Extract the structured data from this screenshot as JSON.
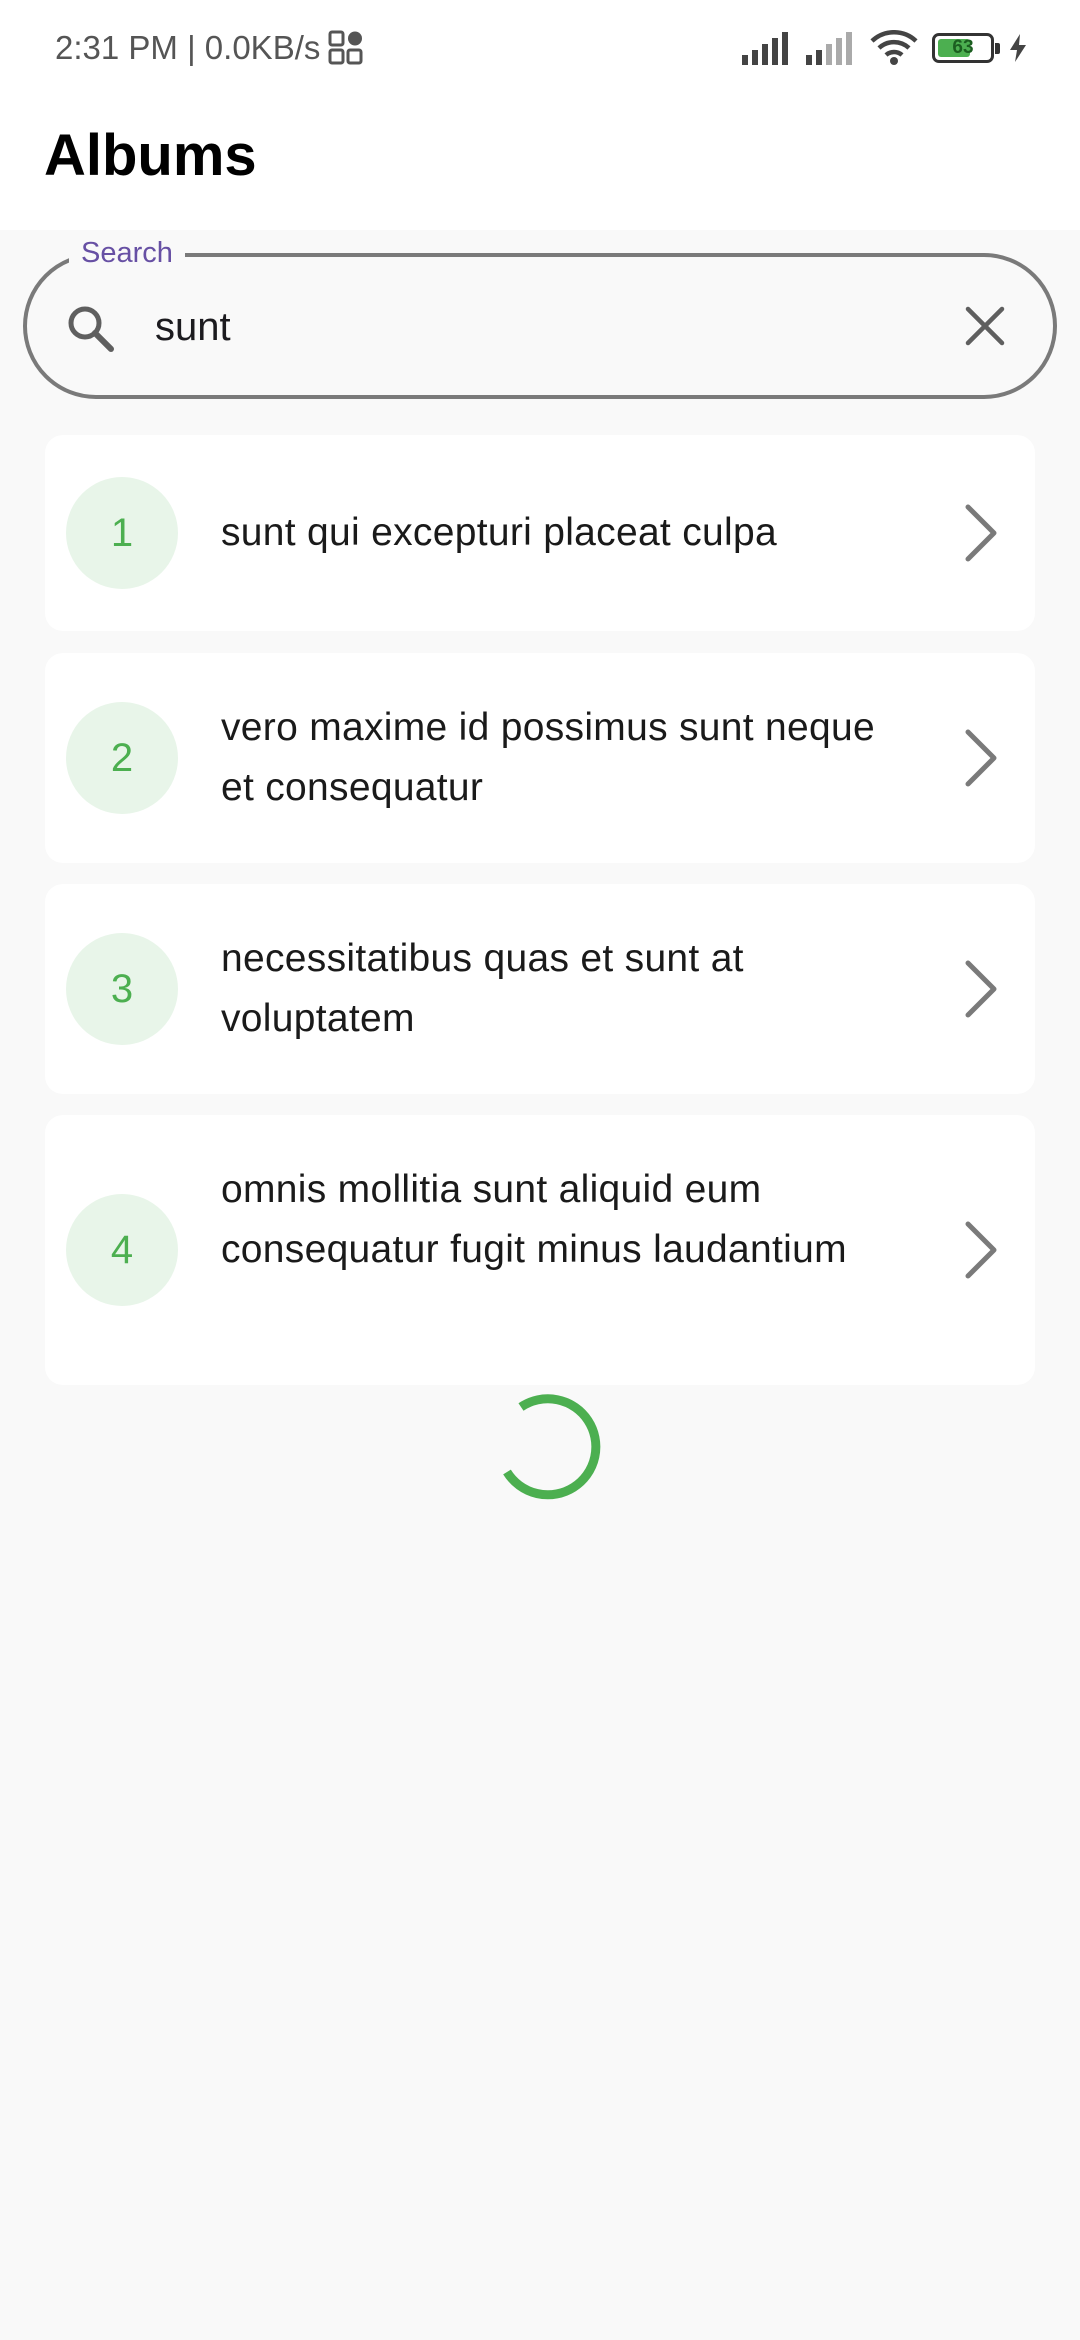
{
  "status_bar": {
    "time_speed": "2:31 PM | 0.0KB/s",
    "battery_level": "63",
    "icons": [
      "apps-icon",
      "signal-icon",
      "signal-icon",
      "wifi-icon",
      "battery-icon",
      "charging-icon"
    ]
  },
  "app_bar": {
    "title": "Albums"
  },
  "search": {
    "label": "Search",
    "value": "sunt",
    "icon": "search-icon",
    "clear_icon": "close-icon"
  },
  "albums": [
    {
      "number": "1",
      "title": "sunt qui excepturi placeat culpa"
    },
    {
      "number": "2",
      "title": "vero maxime id possimus sunt neque et consequatur"
    },
    {
      "number": "3",
      "title": "necessitatibus quas et sunt at voluptatem"
    },
    {
      "number": "4",
      "title": "omnis mollitia sunt aliquid eum consequatur fugit minus laudantium"
    }
  ],
  "colors": {
    "accent": "#4caf50",
    "avatar_bg": "#e8f5e9",
    "label": "#6750a4",
    "outline": "#7a7a7a"
  }
}
